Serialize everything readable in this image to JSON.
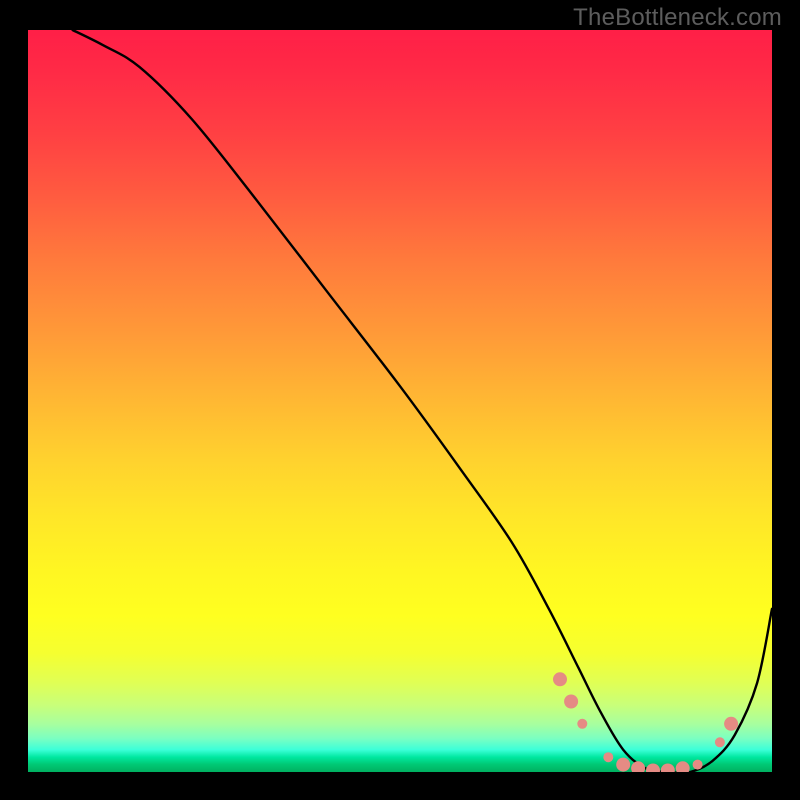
{
  "watermark": "TheBottleneck.com",
  "chart_data": {
    "type": "line",
    "title": "",
    "xlabel": "",
    "ylabel": "",
    "xlim": [
      0,
      100
    ],
    "ylim": [
      0,
      100
    ],
    "grid": false,
    "legend": false,
    "series": [
      {
        "name": "bottleneck-curve",
        "color": "#000000",
        "x": [
          6,
          10,
          15,
          22,
          30,
          40,
          50,
          58,
          65,
          70,
          74,
          77,
          80,
          83,
          86,
          89,
          92,
          95,
          98,
          100
        ],
        "y": [
          100,
          98,
          95,
          88,
          78,
          65,
          52,
          41,
          31,
          22,
          14,
          8,
          3,
          0.5,
          0,
          0,
          1.5,
          5,
          12,
          22
        ]
      }
    ],
    "markers": {
      "name": "highlight-dots",
      "color": "#e58b84",
      "radius_small": 5,
      "radius_large": 7,
      "points": [
        {
          "x": 71.5,
          "y": 12.5,
          "r": 7
        },
        {
          "x": 73.0,
          "y": 9.5,
          "r": 7
        },
        {
          "x": 74.5,
          "y": 6.5,
          "r": 5
        },
        {
          "x": 78.0,
          "y": 2.0,
          "r": 5
        },
        {
          "x": 80.0,
          "y": 1.0,
          "r": 7
        },
        {
          "x": 82.0,
          "y": 0.5,
          "r": 7
        },
        {
          "x": 84.0,
          "y": 0.2,
          "r": 7
        },
        {
          "x": 86.0,
          "y": 0.2,
          "r": 7
        },
        {
          "x": 88.0,
          "y": 0.5,
          "r": 7
        },
        {
          "x": 90.0,
          "y": 1.0,
          "r": 5
        },
        {
          "x": 93.0,
          "y": 4.0,
          "r": 5
        },
        {
          "x": 94.5,
          "y": 6.5,
          "r": 7
        }
      ]
    },
    "gradient_stops": [
      {
        "pos": 0.0,
        "color": "#ff1f47"
      },
      {
        "pos": 0.5,
        "color": "#ffb833"
      },
      {
        "pos": 0.8,
        "color": "#ffff20"
      },
      {
        "pos": 0.95,
        "color": "#7affc2"
      },
      {
        "pos": 1.0,
        "color": "#00b060"
      }
    ]
  }
}
